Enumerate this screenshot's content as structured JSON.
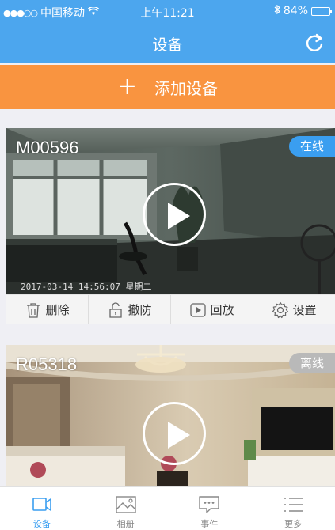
{
  "status_bar": {
    "signal_dots": "●●●○○",
    "carrier": "中国移动",
    "time": "上午11:21",
    "battery_text": "84%",
    "battery_level": 0.84
  },
  "nav": {
    "title": "设备",
    "refresh_icon": "refresh-icon"
  },
  "add_device": {
    "plus": "+",
    "label": "添加设备"
  },
  "devices": [
    {
      "id": "M00596",
      "status": "在线",
      "timestamp": "2017-03-14 14:56:07 星期二",
      "actions": [
        {
          "label": "删除",
          "icon": "trash-icon"
        },
        {
          "label": "撤防",
          "icon": "disarm-icon"
        },
        {
          "label": "回放",
          "icon": "playback-icon"
        },
        {
          "label": "设置",
          "icon": "gear-icon"
        }
      ]
    },
    {
      "id": "R05318",
      "status": "离线"
    }
  ],
  "tabs": [
    {
      "label": "设备",
      "icon": "camera-icon",
      "active": true
    },
    {
      "label": "相册",
      "icon": "photo-icon",
      "active": false
    },
    {
      "label": "事件",
      "icon": "chat-icon",
      "active": false
    },
    {
      "label": "更多",
      "icon": "list-icon",
      "active": false
    }
  ],
  "colors": {
    "header_blue": "#4ca6ee",
    "add_orange": "#f99440",
    "online_blue": "#3a9ef0",
    "offline_gray": "#b9b9b9"
  }
}
